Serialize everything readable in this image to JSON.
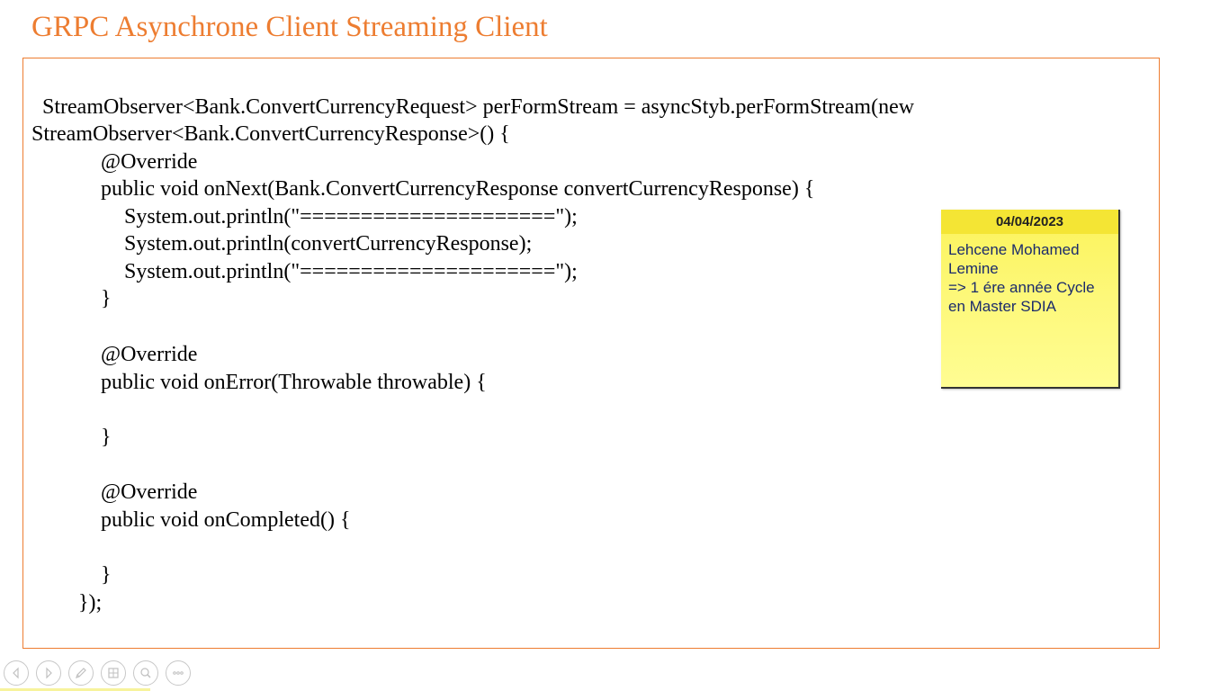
{
  "slide": {
    "title": "GRPC Asynchrone Client Streaming Client"
  },
  "code": {
    "lines": [
      " StreamObserver<Bank.ConvertCurrencyRequest> perFormStream = asyncStyb.perFormStream(new",
      "StreamObserver<Bank.ConvertCurrencyResponse>() {",
      "@Override",
      "public void onNext(Bank.ConvertCurrencyResponse convertCurrencyResponse) {",
      "System.out.println(\"=====================\");",
      "System.out.println(convertCurrencyResponse);",
      "System.out.println(\"=====================\");",
      "}",
      "@Override",
      "public void onError(Throwable throwable) {",
      "}",
      "@Override",
      "public void onCompleted() {",
      "}",
      "});"
    ]
  },
  "note": {
    "date": "04/04/2023",
    "lines": [
      "Lehcene Mohamed",
      "Lemine",
      "=> 1 ére année Cycle",
      "en Master SDIA"
    ]
  },
  "navigation": {
    "buttons": [
      {
        "icon": "previous-icon"
      },
      {
        "icon": "next-icon"
      },
      {
        "icon": "pen-icon"
      },
      {
        "icon": "slides-grid-icon"
      },
      {
        "icon": "zoom-icon"
      },
      {
        "icon": "more-options-icon"
      }
    ]
  },
  "colors": {
    "title": "#ED7D31",
    "box_border": "#ED7D31",
    "note_header": "#f4e534",
    "note_body": "#fdf87a",
    "note_text": "#1b2b6b"
  }
}
